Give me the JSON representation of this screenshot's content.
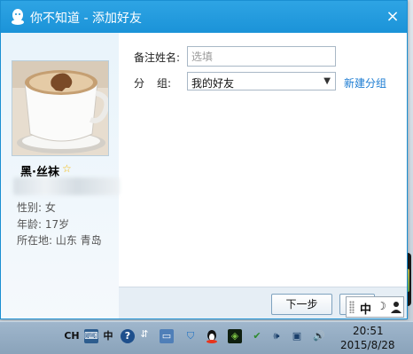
{
  "window": {
    "title": "你不知道 - 添加好友",
    "close_icon": "×",
    "accent_color": "#1b93d8"
  },
  "profile": {
    "nickname": "黑·丝袜",
    "star": "☆",
    "gender": "性别: 女",
    "age": "年龄: 17岁",
    "location": "所在地: 山东  青岛"
  },
  "form": {
    "remark_label": "备注姓名:",
    "remark_placeholder": "选填",
    "group_label_1": "分",
    "group_label_2": "组:",
    "group_value": "我的好友",
    "group_arrow": "▼",
    "new_group_link": "新建分组"
  },
  "buttons": {
    "next_label": "下一步"
  },
  "ime": {
    "lang": "中",
    "moon": "☽"
  },
  "taskbar": {
    "tray": {
      "lang": "CH",
      "ime": "中",
      "help": "?"
    },
    "time": "20:51",
    "date": "2015/8/28"
  }
}
